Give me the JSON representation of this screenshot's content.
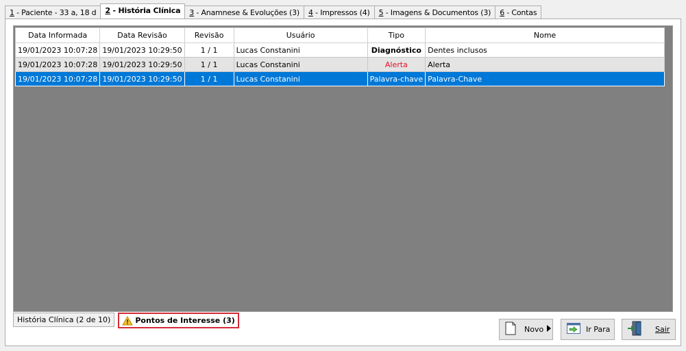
{
  "tabs": [
    {
      "key": "1",
      "label": " - Paciente - 33 a, 18 d"
    },
    {
      "key": "2",
      "label": " - História Clínica"
    },
    {
      "key": "3",
      "label": " - Anamnese & Evoluções  (3)"
    },
    {
      "key": "4",
      "label": " - Impressos  (4)"
    },
    {
      "key": "5",
      "label": " - Imagens & Documentos  (3)"
    },
    {
      "key": "6",
      "label": " - Contas"
    }
  ],
  "grid": {
    "headers": [
      "Data Informada",
      "Data Revisão",
      "Revisão",
      "Usuário",
      "Tipo",
      "Nome"
    ],
    "rows": [
      {
        "data_informada": "19/01/2023 10:07:28",
        "data_revisao": "19/01/2023 10:29:50",
        "revisao": "1 / 1",
        "usuario": "Lucas Constanini",
        "tipo": "Diagnóstico",
        "nome": "Dentes inclusos"
      },
      {
        "data_informada": "19/01/2023 10:07:28",
        "data_revisao": "19/01/2023 10:29:50",
        "revisao": "1 / 1",
        "usuario": "Lucas Constanini",
        "tipo": "Alerta",
        "nome": "Alerta"
      },
      {
        "data_informada": "19/01/2023 10:07:28",
        "data_revisao": "19/01/2023 10:29:50",
        "revisao": "1 / 1",
        "usuario": "Lucas Constanini",
        "tipo": "Palavra-chave",
        "nome": "Palavra-Chave"
      }
    ]
  },
  "bottom_tabs": {
    "historia": "História Clínica (2 de 10)",
    "pontos": "Pontos de Interesse (3)"
  },
  "buttons": {
    "novo": "Novo",
    "ir_para": "Ir Para",
    "sair": "Sair"
  },
  "colors": {
    "selection": "#0078d7",
    "alert": "#e81123",
    "highlight_border": "#d62b3a",
    "grid_background": "#808080"
  },
  "icons": [
    "warning-icon",
    "new-document-icon",
    "arrow-right-icon",
    "go-to-icon",
    "exit-door-icon"
  ]
}
